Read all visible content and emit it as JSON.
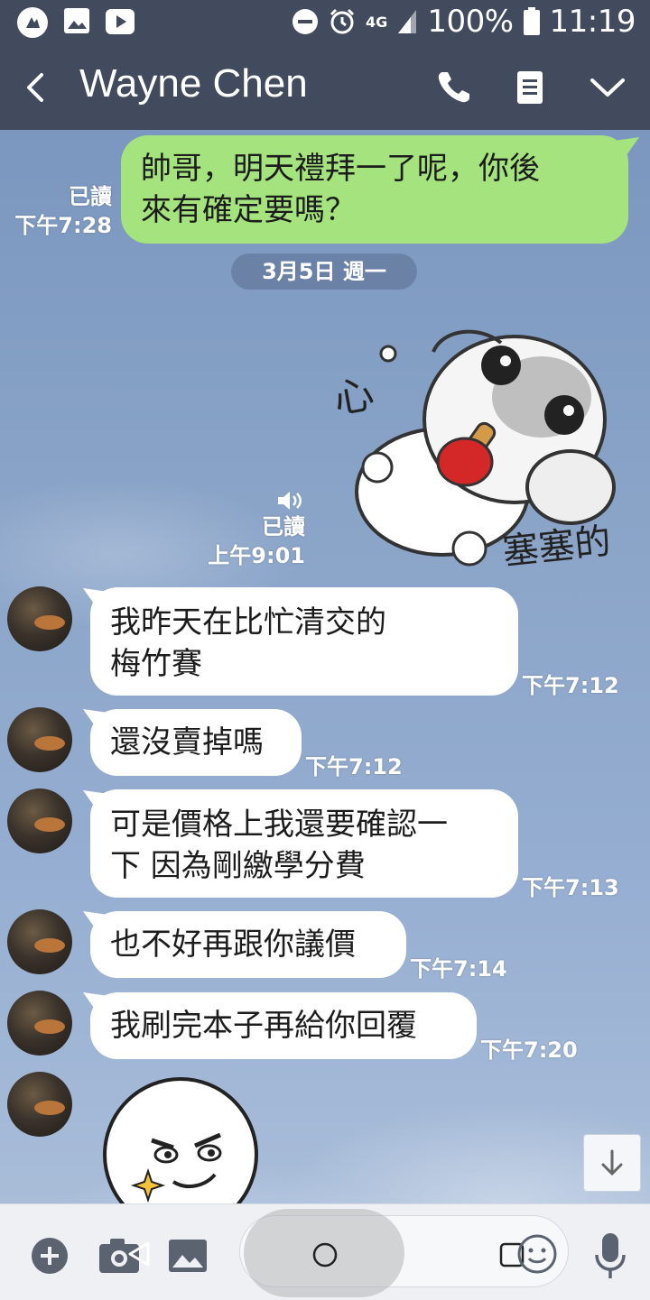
{
  "status_bar": {
    "battery": "100%",
    "time": "11:19",
    "network": "4G"
  },
  "header": {
    "contact_name": "Wayne Chen",
    "icons": [
      "back-icon",
      "phone-icon",
      "notes-icon",
      "chevron-down-icon"
    ]
  },
  "messages": {
    "m1": {
      "direction": "out",
      "lines": [
        "帥哥，明天禮拜一了呢，你後",
        "來有確定要嗎？"
      ],
      "read": "已讀",
      "time": "下午7:28"
    },
    "date_divider": "3月5日 週一",
    "sticker_out": {
      "caption_left": "心",
      "caption_right": "塞塞的",
      "read": "已讀",
      "time": "上午9:01"
    },
    "m2": {
      "direction": "in",
      "lines": [
        "我昨天在比忙清交的",
        "梅竹賽"
      ],
      "time": "下午7:12"
    },
    "m3": {
      "direction": "in",
      "lines": [
        "還沒賣掉嗎"
      ],
      "time": "下午7:12"
    },
    "m4": {
      "direction": "in",
      "lines": [
        "可是價格上我還要確認一",
        "下 因為剛繳學分費"
      ],
      "time": "下午7:13"
    },
    "m5": {
      "direction": "in",
      "lines": [
        "也不好再跟你議價"
      ],
      "time": "下午7:14"
    },
    "m6": {
      "direction": "in",
      "lines": [
        "我刷完本子再給你回覆"
      ],
      "time": "下午7:20"
    }
  },
  "colors": {
    "header_bg": "#424b5d",
    "outgoing_bubble": "#a4e37d",
    "incoming_bubble": "#ffffff",
    "chat_bg": "#8aa4c8"
  },
  "bottom_bar": {
    "icons": [
      "plus-icon",
      "camera-icon",
      "image-icon",
      "emoji-icon",
      "microphone-icon"
    ]
  }
}
